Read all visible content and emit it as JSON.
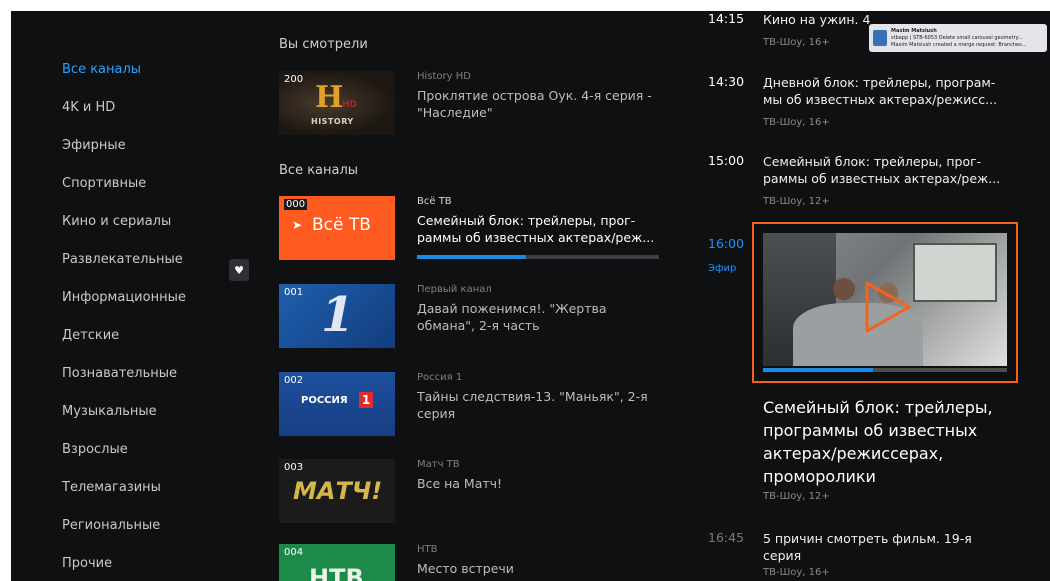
{
  "categories": [
    {
      "label": "Все каналы",
      "active": true
    },
    {
      "label": "4K и HD"
    },
    {
      "label": "Эфирные"
    },
    {
      "label": "Спортивные"
    },
    {
      "label": "Кино и сериалы"
    },
    {
      "label": "Развлекательные"
    },
    {
      "label": "Информационные"
    },
    {
      "label": "Детские"
    },
    {
      "label": "Познавательные"
    },
    {
      "label": "Музыкальные"
    },
    {
      "label": "Взрослые"
    },
    {
      "label": "Телемагазины"
    },
    {
      "label": "Региональные"
    },
    {
      "label": "Прочие"
    }
  ],
  "sections": {
    "recent_title": "Вы смотрели",
    "all_title": "Все каналы"
  },
  "recent": [
    {
      "number": "200",
      "logo": "HISTORY",
      "logo_badge": "HD",
      "channel": "History HD",
      "program": "Проклятие острова Оук. 4-я серия - \"Наследие\""
    }
  ],
  "channels": [
    {
      "number": "000",
      "logo": "Всё ТВ",
      "channel": "Всё ТВ",
      "program": "Семейный блок: трейлеры, прог- раммы об известных актерах/реж...",
      "active": true,
      "progress": 0.45
    },
    {
      "number": "001",
      "logo": "1",
      "channel": "Первый канал",
      "program": "Давай поженимся!. \"Жертва обмана\", 2-я часть"
    },
    {
      "number": "002",
      "logo": "РОССИЯ",
      "logo_badge": "1",
      "channel": "Россия 1",
      "program": "Тайны следствия-13. \"Маньяк\", 2-я серия"
    },
    {
      "number": "003",
      "logo": "МАТЧ!",
      "channel": "Матч ТВ",
      "program": "Все на Матч!"
    },
    {
      "number": "004",
      "logo": "НТВ",
      "channel": "НТВ",
      "program": "Место встречи"
    }
  ],
  "schedule": [
    {
      "time": "14:15",
      "title": "Кино на ужин. 4",
      "meta": "ТВ-Шоу, 16+"
    },
    {
      "time": "14:30",
      "title": "Дневной блок: трейлеры, програм- мы об известных актерах/режисс...",
      "meta": "ТВ-Шоу, 16+"
    },
    {
      "time": "15:00",
      "title": "Семейный блок: трейлеры, прог- раммы об известных актерах/реж...",
      "meta": "ТВ-Шоу, 12+"
    },
    {
      "time": "16:00",
      "live_label": "Эфир",
      "title": "Семейный блок: трейлеры, программы об известных актерах/режиссерах, проморолики",
      "meta": "ТВ-Шоу, 12+",
      "progress": 0.45
    },
    {
      "time": "16:45",
      "title": "5 причин смотреть фильм. 19-я серия",
      "meta": "ТВ-Шоу, 16+"
    }
  ],
  "heart_icon": "heart-icon",
  "notification": {
    "author": "Maxim Matsiush",
    "line1": "stbapp | STB-6053 Delete small carousel geometry...",
    "line2": "Maxim Matsiush created a merge request: Branches..."
  },
  "colors": {
    "accent_blue": "#28a2ff",
    "focus_orange": "#f4631e",
    "background": "#0f1012",
    "vse_tv_orange": "#ff5a1f"
  }
}
